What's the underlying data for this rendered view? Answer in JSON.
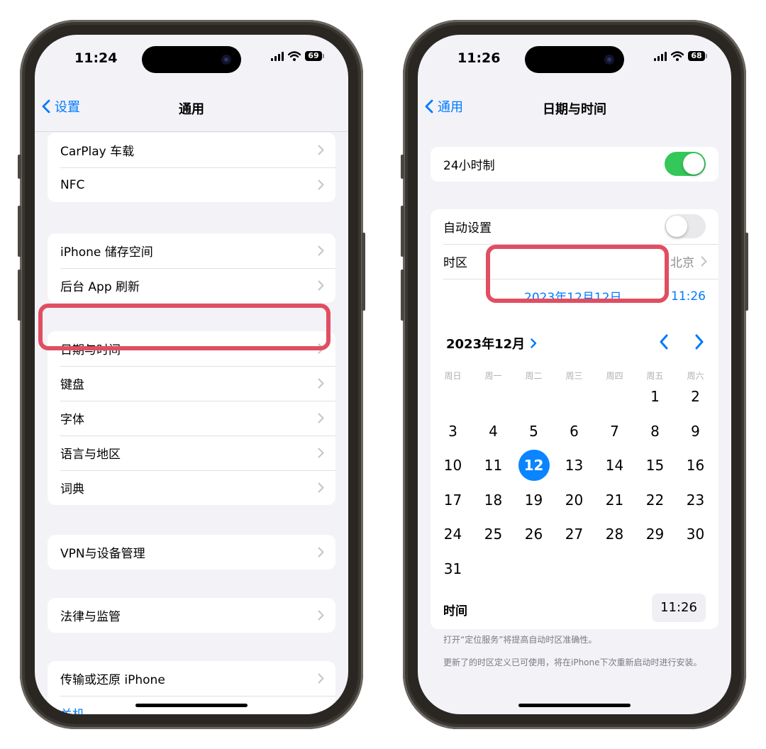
{
  "left_phone": {
    "status": {
      "time": "11:24",
      "battery": "69"
    },
    "nav": {
      "back_label": "设置",
      "title": "通用"
    },
    "groups": [
      [
        "CarPlay 车载",
        "NFC"
      ],
      [
        "iPhone 储存空间",
        "后台 App 刷新"
      ],
      [
        "日期与时间",
        "键盘",
        "字体",
        "语言与地区",
        "词典"
      ],
      [
        "VPN与设备管理"
      ],
      [
        "法律与监管"
      ],
      [
        "传输或还原 iPhone",
        "关机"
      ]
    ]
  },
  "right_phone": {
    "status": {
      "time": "11:26",
      "battery": "68"
    },
    "nav": {
      "back_label": "通用",
      "title": "日期与时间"
    },
    "hour24": {
      "label": "24小时制",
      "on": true
    },
    "auto_set": {
      "label": "自动设置",
      "on": false
    },
    "timezone": {
      "label": "时区",
      "value": "北京"
    },
    "selected_date": "2023年12月12日",
    "selected_time": "11:26",
    "calendar": {
      "month_label": "2023年12月",
      "weekdays": [
        "周日",
        "周一",
        "周二",
        "周三",
        "周四",
        "周五",
        "周六"
      ],
      "first_weekday_index": 5,
      "days_in_month": 31,
      "selected_day": 12
    },
    "time_row": {
      "label": "时间",
      "value": "11:26"
    },
    "footnotes": [
      "打开“定位服务”将提高自动时区准确性。",
      "更新了的时区定义已可使用，将在iPhone下次重新启动时进行安装。"
    ]
  },
  "colors": {
    "accent": "#007aff",
    "toggle_on": "#34c759",
    "highlight": "#e04e62",
    "selected_day": "#0a84ff"
  }
}
